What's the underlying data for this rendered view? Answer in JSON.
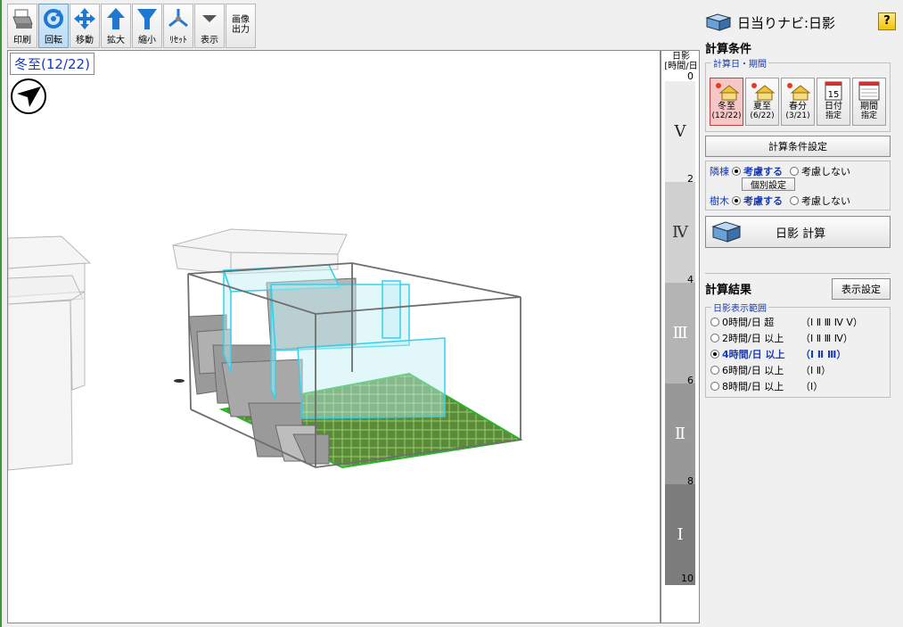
{
  "toolbar": [
    {
      "id": "print",
      "label": "印刷",
      "icon": "printer-icon"
    },
    {
      "id": "rotate",
      "label": "回転",
      "icon": "rotate-icon",
      "active": true
    },
    {
      "id": "move",
      "label": "移動",
      "icon": "move-icon"
    },
    {
      "id": "zoom_in",
      "label": "拡大",
      "icon": "zoom-in-icon"
    },
    {
      "id": "zoom_out",
      "label": "縮小",
      "icon": "zoom-out-icon"
    },
    {
      "id": "reset",
      "label": "ﾘｾｯﾄ",
      "icon": "reset-icon"
    },
    {
      "id": "display",
      "label": "表示",
      "icon": "display-menu-icon"
    },
    {
      "id": "image_out",
      "label_line1": "画像",
      "label_line2": "出力"
    }
  ],
  "viewport": {
    "date_label": "冬至(12/22)",
    "compass_icon": "north-arrow-icon"
  },
  "scale": {
    "title_line1": "日影",
    "title_line2": "[時間/日",
    "ticks": [
      "0",
      "2",
      "4",
      "6",
      "8",
      "10"
    ],
    "bands": [
      {
        "roman": "Ⅴ",
        "color": "#ececec"
      },
      {
        "roman": "Ⅳ",
        "color": "#d0d0d0"
      },
      {
        "roman": "Ⅲ",
        "color": "#b4b4b4"
      },
      {
        "roman": "Ⅱ",
        "color": "#989898"
      },
      {
        "roman": "Ⅰ",
        "color": "#7c7c7c"
      }
    ]
  },
  "panel": {
    "title": "日当りナビ:日影",
    "help_label": "?",
    "conditions_heading": "計算条件",
    "date_group_label": "計算日・期間",
    "date_buttons": [
      {
        "label": "冬至",
        "sub": "(12/22)",
        "active": true
      },
      {
        "label": "夏至",
        "sub": "(6/22)"
      },
      {
        "label": "春分",
        "sub": "(3/21)"
      },
      {
        "label": "日付",
        "sub": "指定"
      },
      {
        "label": "期間",
        "sub": "指定"
      }
    ],
    "calc_settings_button": "計算条件設定",
    "neighbor_label": "隣棟",
    "tree_label": "樹木",
    "consider_label": "考慮する",
    "not_consider_label": "考慮しない",
    "individual_button": "個別設定",
    "calc_button": "日影 計算",
    "results_heading": "計算結果",
    "display_settings_button": "表示設定",
    "range_group_label": "日影表示範囲",
    "ranges": [
      {
        "label": "0時間/日 超",
        "roman": "（Ⅰ Ⅱ Ⅲ Ⅳ Ⅴ）",
        "selected": false
      },
      {
        "label": "2時間/日 以上",
        "roman": "（Ⅰ Ⅱ Ⅲ Ⅳ）",
        "selected": false
      },
      {
        "label": "4時間/日 以上",
        "roman": "（Ⅰ Ⅱ Ⅲ）",
        "selected": true
      },
      {
        "label": "6時間/日 以上",
        "roman": "（Ⅰ Ⅱ）",
        "selected": false
      },
      {
        "label": "8時間/日 以上",
        "roman": "（Ⅰ）",
        "selected": false
      }
    ]
  }
}
